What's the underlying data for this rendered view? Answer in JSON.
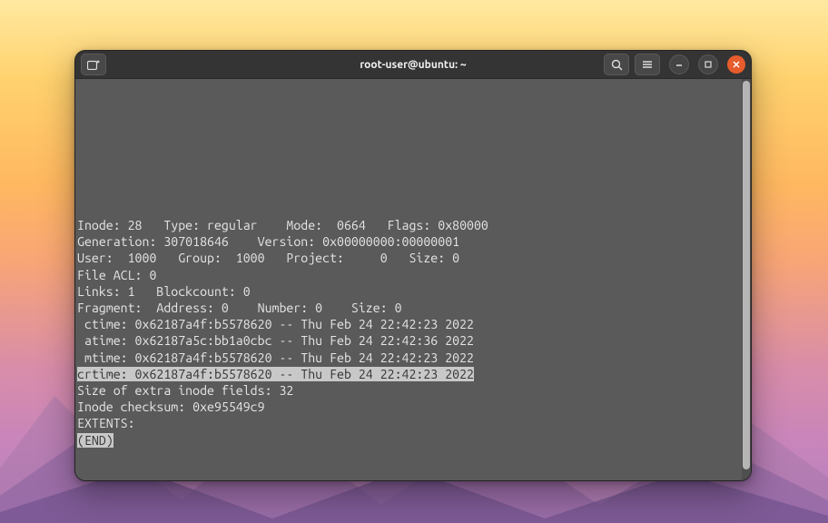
{
  "window_title": "root-user@ubuntu: ~",
  "icons": {
    "newtab": "new-tab-icon",
    "search": "search-icon",
    "menu": "hamburger-icon",
    "minimize": "minimize-icon",
    "maximize": "maximize-icon",
    "close": "close-icon"
  },
  "lines": {
    "l0": "Inode: 28   Type: regular    Mode:  0664   Flags: 0x80000",
    "l1": "Generation: 307018646    Version: 0x00000000:00000001",
    "l2": "User:  1000   Group:  1000   Project:     0   Size: 0",
    "l3": "File ACL: 0",
    "l4": "Links: 1   Blockcount: 0",
    "l5": "Fragment:  Address: 0    Number: 0    Size: 0",
    "l6": " ctime: 0x62187a4f:b5578620 -- Thu Feb 24 22:42:23 2022",
    "l7": " atime: 0x62187a5c:bb1a0cbc -- Thu Feb 24 22:42:36 2022",
    "l8": " mtime: 0x62187a4f:b5578620 -- Thu Feb 24 22:42:23 2022",
    "l9": "crtime: 0x62187a4f:b5578620 -- Thu Feb 24 22:42:23 2022",
    "l10": "Size of extra inode fields: 32",
    "l11": "Inode checksum: 0xe95549c9",
    "l12": "EXTENTS:",
    "l13": "(END)"
  }
}
